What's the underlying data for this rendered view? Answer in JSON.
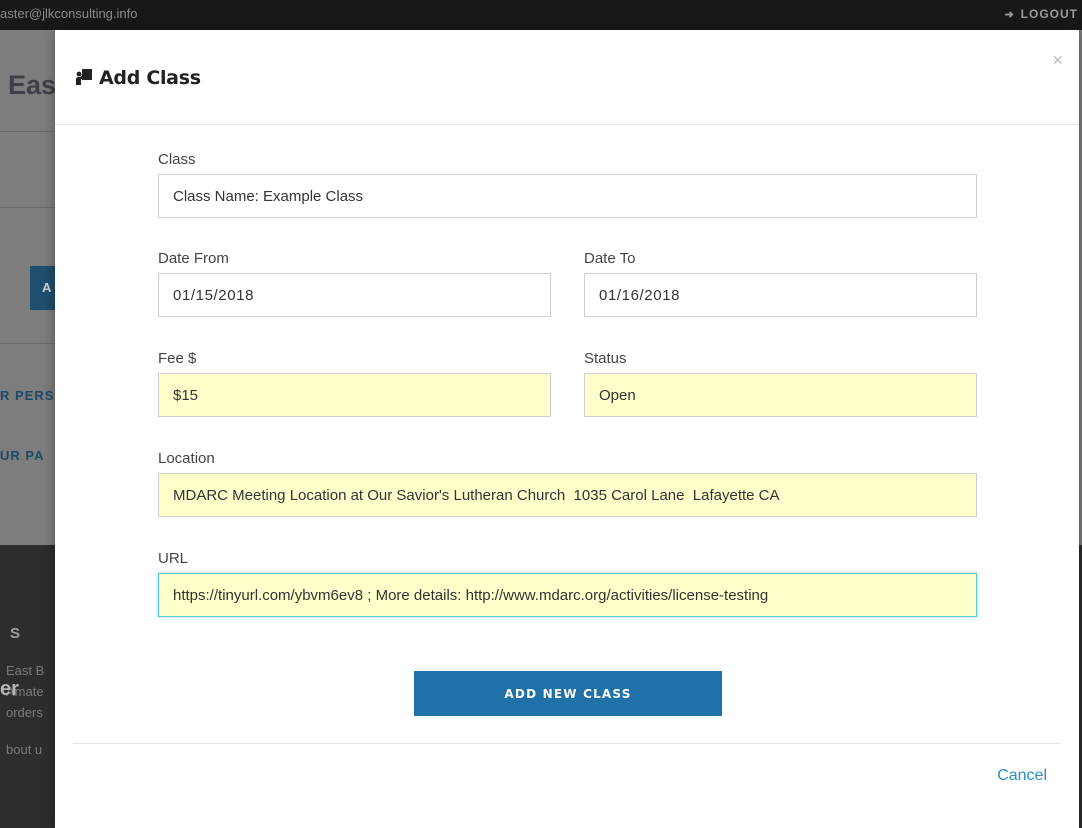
{
  "topbar": {
    "email": "aster@jlkconsulting.info",
    "logout_label": "LOGOUT",
    "logout_icon": "sign-out-icon"
  },
  "background": {
    "title": "Eas",
    "button_label": "A",
    "link1": "R PERS",
    "link2": "UR PA",
    "footer_heading": "S",
    "footer_line1": "East B",
    "footer_line2": "Amate",
    "footer_line3": "orders",
    "footer_line4": "bout u",
    "footer_big": "er"
  },
  "modal": {
    "title": "Add Class",
    "title_icon": "chalkboard-teacher-icon",
    "close_label": "×",
    "fields": {
      "class": {
        "label": "Class",
        "value": "Class Name: Example Class"
      },
      "date_from": {
        "label": "Date From",
        "value": "01/15/2018"
      },
      "date_to": {
        "label": "Date To",
        "value": "01/16/2018"
      },
      "fee": {
        "label": "Fee $",
        "value": "$15"
      },
      "status": {
        "label": "Status",
        "value": "Open"
      },
      "location": {
        "label": "Location",
        "value": "MDARC Meeting Location at Our Savior's Lutheran Church  1035 Carol Lane  Lafayette CA"
      },
      "url": {
        "label": "URL",
        "value": "https://tinyurl.com/ybvm6ev8 ; More details: http://www.mdarc.org/activities/license-testing"
      }
    },
    "submit_label": "ADD NEW CLASS",
    "cancel_label": "Cancel"
  }
}
